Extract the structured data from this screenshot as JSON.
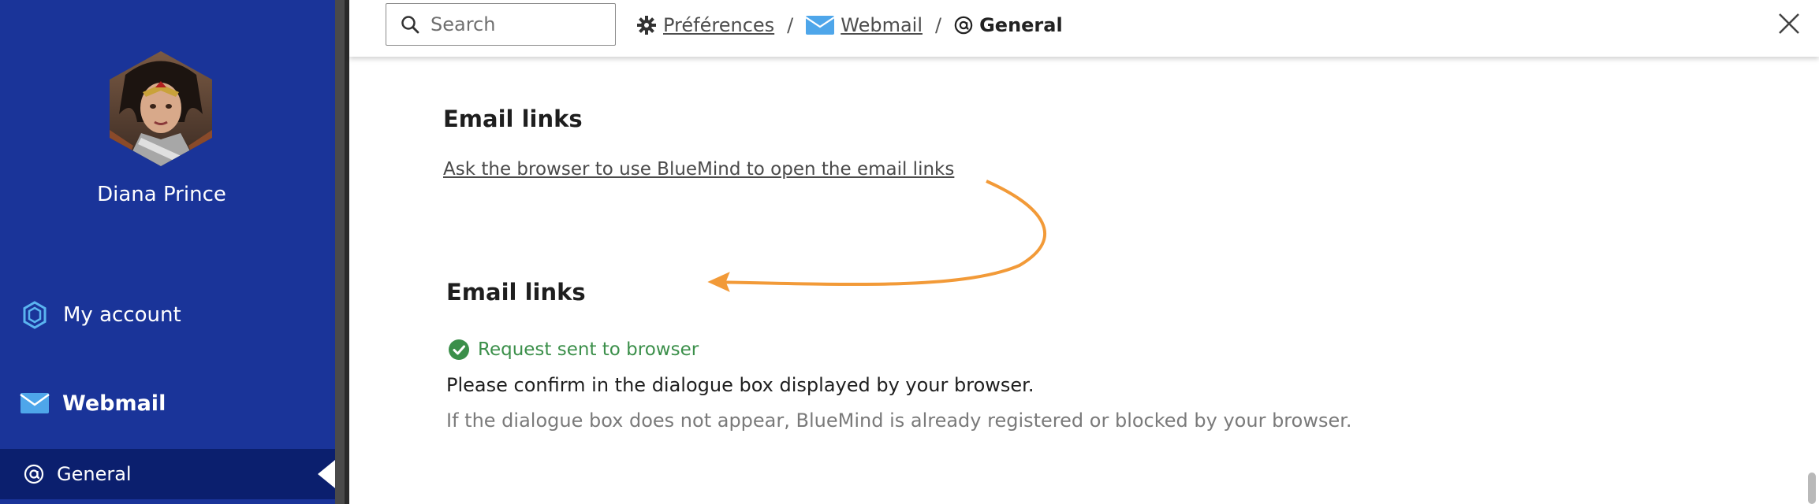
{
  "sidebar": {
    "user_name": "Diana Prince",
    "items": [
      {
        "label": "My account",
        "icon": "account-icon"
      },
      {
        "label": "Webmail",
        "icon": "envelope-icon"
      },
      {
        "label": "General",
        "icon": "at-sign-icon",
        "active": true
      }
    ],
    "colors": {
      "background": "#1a3499",
      "active_background": "#0b1f6e"
    }
  },
  "topbar": {
    "search": {
      "placeholder": "Search",
      "value": ""
    },
    "breadcrumb": [
      {
        "label": "Préférences",
        "icon": "gear-icon",
        "link": true
      },
      {
        "label": "Webmail",
        "icon": "envelope-icon",
        "link": true
      },
      {
        "label": "General",
        "icon": "at-sign-icon",
        "link": false
      }
    ],
    "separator": "/",
    "close_icon": "close-icon"
  },
  "content": {
    "section_before": {
      "title": "Email links",
      "link_text": "Ask the browser to use BlueMind to open the email links"
    },
    "section_after": {
      "title": "Email links",
      "status": "Request sent to browser",
      "confirm_text": "Please confirm in the dialogue box displayed by your browser.",
      "hint_text": "If the dialogue box does not appear, BlueMind is already registered or blocked by your browser."
    },
    "annotation_arrow_color": "#f29a38",
    "success_color": "#3b8f4a"
  }
}
